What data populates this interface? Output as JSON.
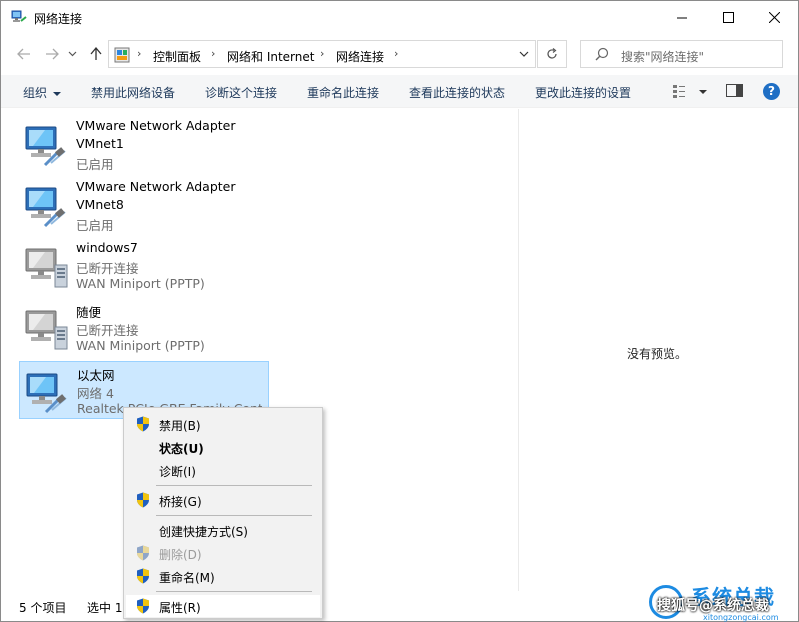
{
  "window": {
    "title": "网络连接"
  },
  "address": {
    "crumbs": [
      "控制面板",
      "网络和 Internet",
      "网络连接"
    ],
    "search_placeholder": "搜索\"网络连接\""
  },
  "toolbar": {
    "organize": "组织",
    "disable_device": "禁用此网络设备",
    "diagnose": "诊断这个连接",
    "rename": "重命名此连接",
    "view_status": "查看此连接的状态",
    "change_settings": "更改此连接的设置",
    "help": "?"
  },
  "connections": [
    {
      "name": "VMware Network Adapter VMnet1",
      "name_line1": "VMware Network Adapter",
      "name_line2": "VMnet1",
      "status": "已启用",
      "device": "",
      "type": "ethernet"
    },
    {
      "name": "VMware Network Adapter VMnet8",
      "name_line1": "VMware Network Adapter",
      "name_line2": "VMnet8",
      "status": "已启用",
      "device": "",
      "type": "ethernet"
    },
    {
      "name": "windows7",
      "name_line1": "windows7",
      "status": "已断开连接",
      "device": "WAN Miniport (PPTP)",
      "type": "vpn"
    },
    {
      "name": "随便",
      "name_line1": "随便",
      "status": "已断开连接",
      "device": "WAN Miniport (PPTP)",
      "type": "vpn"
    },
    {
      "name": "以太网",
      "name_line1": "以太网",
      "status": "网络 4",
      "device": "Realtek PCIe GBE Family Contr",
      "type": "ethernet",
      "selected": true
    }
  ],
  "preview": {
    "message": "没有预览。"
  },
  "statusbar": {
    "count": "5 个项目",
    "selected": "选中 1"
  },
  "context_menu": {
    "items": [
      {
        "label": "禁用(B)",
        "shield": true
      },
      {
        "label": "状态(U)",
        "bold": true
      },
      {
        "label": "诊断(I)"
      },
      {
        "label": "桥接(G)",
        "shield": true
      },
      {
        "label": "创建快捷方式(S)"
      },
      {
        "label": "删除(D)",
        "shield": true,
        "disabled": true
      },
      {
        "label": "重命名(M)",
        "shield": true
      },
      {
        "label": "属性(R)",
        "shield": true
      }
    ]
  },
  "watermark": {
    "big": "系统总裁",
    "overlay": "搜狐号@系统总裁",
    "small": "xitongzongcai.com"
  },
  "colors": {
    "selection_bg": "#cce8ff",
    "selection_border": "#99d1ff",
    "command_text": "#1e395b",
    "help_blue": "#1f6fc5",
    "watermark_blue": "#1d8be2"
  }
}
